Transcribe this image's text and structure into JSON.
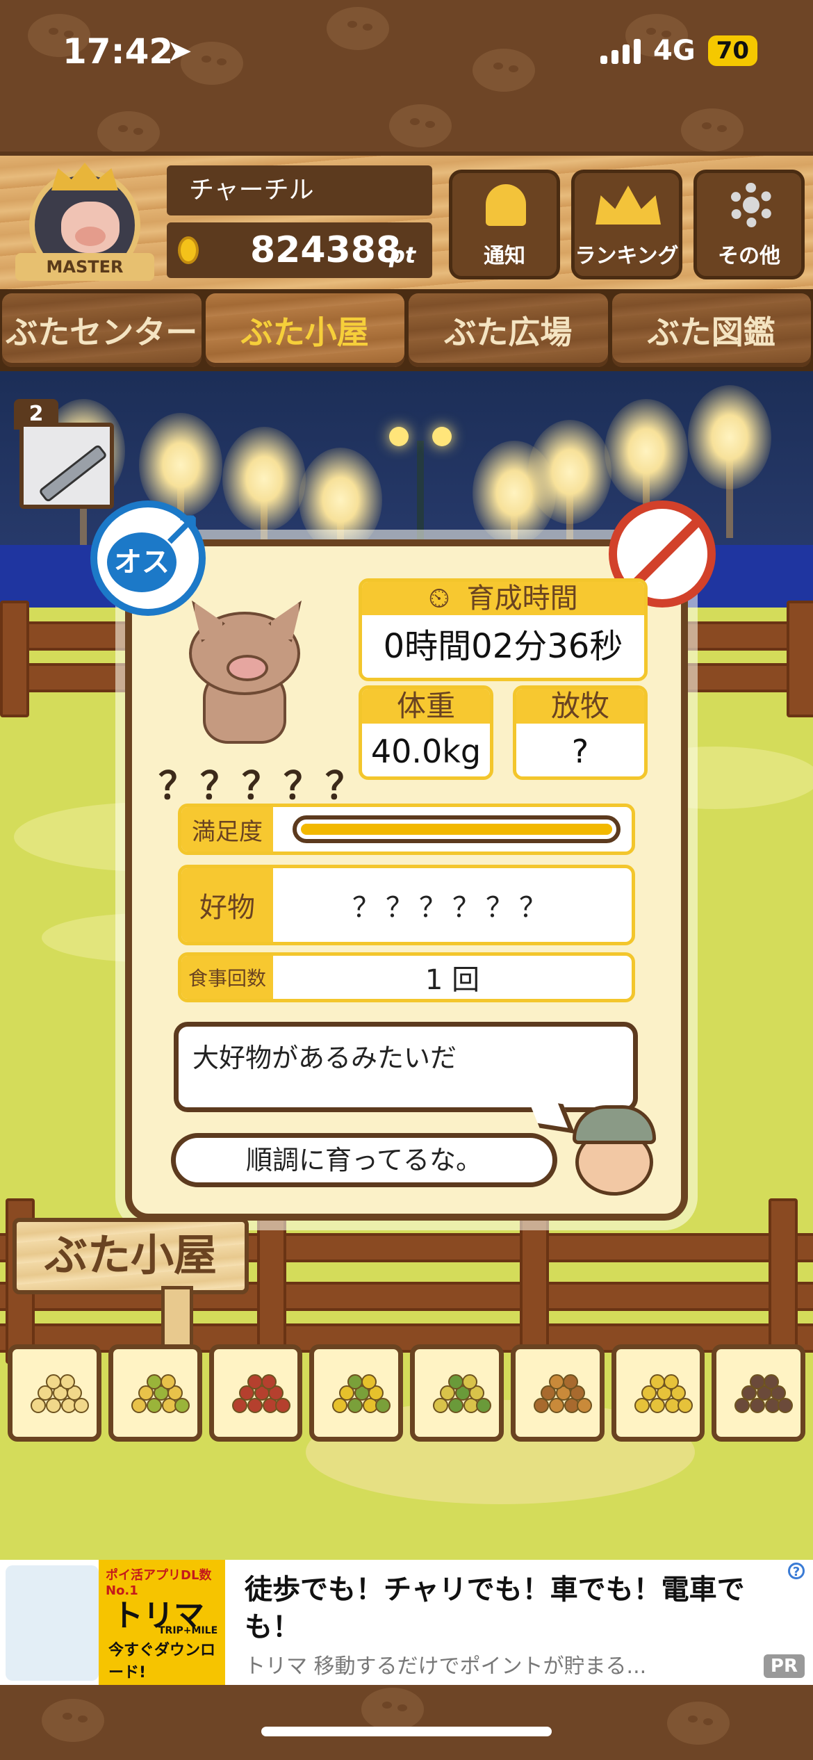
{
  "status_bar": {
    "time": "17:42",
    "network": "4G",
    "battery": "70"
  },
  "player": {
    "badge": "MASTER",
    "name": "チャーチル",
    "points": "824388",
    "points_unit": "pt"
  },
  "header_buttons": {
    "notify": "通知",
    "ranking": "ランキング",
    "other": "その他"
  },
  "tabs": [
    {
      "label": "ぶたセンター"
    },
    {
      "label": "ぶた小屋"
    },
    {
      "label": "ぶた広場"
    },
    {
      "label": "ぶた図鑑"
    }
  ],
  "syringe": {
    "count": "2"
  },
  "pig": {
    "gender": "オス",
    "name": "？？？？？",
    "time_label": "育成時間",
    "time_value": "0時間02分36秒",
    "weight_label": "体重",
    "weight_value": "40.0kg",
    "graze_label": "放牧",
    "graze_value": "?",
    "satisfaction_label": "満足度",
    "satisfaction_level": 1.0,
    "favorite_label": "好物",
    "favorite_value": "？？？？？？",
    "meals_label": "食事回数",
    "meals_value": "1 回"
  },
  "dialog": {
    "message": "大好物があるみたいだ",
    "speech": "順調に育ってるな。"
  },
  "sign": "ぶた小屋",
  "foods": [
    "beans",
    "mixed-beans",
    "sweet-potato",
    "corn",
    "nuts-leaves",
    "acorns",
    "soybeans-plate",
    "chestnuts-plate"
  ],
  "ad": {
    "top_text": "ポイ活アプリDL数No.1",
    "brand": "トリマ",
    "brand_sub": "TRIP+MILE",
    "download": "今すぐダウンロード!",
    "title": "徒歩でも！チャリでも！車でも！電車でも！",
    "subtitle": "トリマ 移動するだけでポイントが貯まる...",
    "pr": "PR"
  },
  "colors": {
    "wood_dark": "#5c3a1e",
    "accent_yellow": "#f7c830",
    "male_blue": "#1c79c8",
    "forbid_red": "#d2412a",
    "grass": "#d4dc5a"
  }
}
